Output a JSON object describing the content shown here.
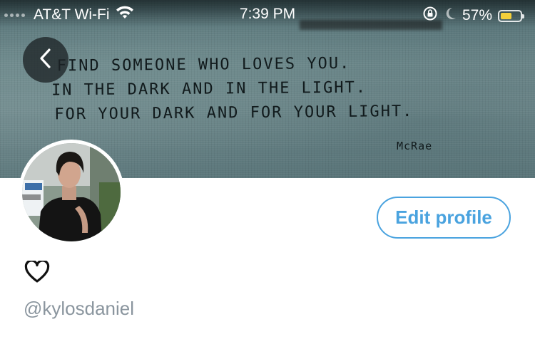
{
  "status_bar": {
    "carrier": "AT&T Wi-Fi",
    "time": "7:39 PM",
    "battery_percent": "57%",
    "battery_level": 0.57,
    "icons": [
      "signal-dots-icon",
      "wifi-icon",
      "orientation-lock-icon",
      "moon-icon",
      "battery-icon"
    ]
  },
  "banner": {
    "quote_lines": [
      "Find someone who loves you.",
      "In the dark and in the light.",
      "For your dark and for your light."
    ],
    "signature": "McRae"
  },
  "header": {
    "back_icon": "chevron-left-icon"
  },
  "profile": {
    "display_name_icon": "heart-outline-icon",
    "handle": "@kylosdaniel",
    "edit_profile_label": "Edit profile"
  },
  "colors": {
    "accent": "#4aa3df",
    "handle_gray": "#8a959e",
    "battery_yellow": "#f4cf3a"
  }
}
